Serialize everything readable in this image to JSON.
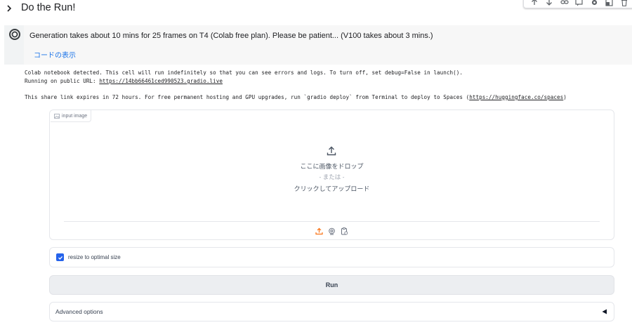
{
  "toolbar": {
    "icons": [
      "move-up-icon",
      "move-down-icon",
      "link-icon",
      "comment-icon",
      "settings-icon",
      "mirror-cell-icon",
      "delete-icon"
    ]
  },
  "section": {
    "title": "Do the Run!"
  },
  "cell": {
    "description": "Generation takes about 10 mins for 25 frames on T4 (Colab free plan). Please be patient... (V100 takes about 3 mins.)",
    "show_code": "コードの表示"
  },
  "output": {
    "line1": "Colab notebook detected. This cell will run indefinitely so that you can see errors and logs. To turn off, set debug=False in launch().",
    "line2_prefix": "Running on public URL: ",
    "public_url": "https://14bb66461ced990523.gradio.live",
    "line3_prefix": "This share link expires in 72 hours. For free permanent hosting and GPU upgrades, run `gradio deploy` from Terminal to deploy to Spaces (",
    "spaces_url": "https://huggingface.co/spaces",
    "line3_suffix": ")"
  },
  "app": {
    "input_image_label": "input image",
    "drop_line1": "ここに画像をドロップ",
    "drop_or": "- または -",
    "drop_line2": "クリックしてアップロード",
    "sources": [
      "upload-icon",
      "webcam-icon",
      "clipboard-icon"
    ],
    "accent_color": "#f97316",
    "checkbox_label": "resize to optimal size",
    "checkbox_checked": true,
    "run_label": "Run",
    "advanced_label": "Advanced options"
  }
}
